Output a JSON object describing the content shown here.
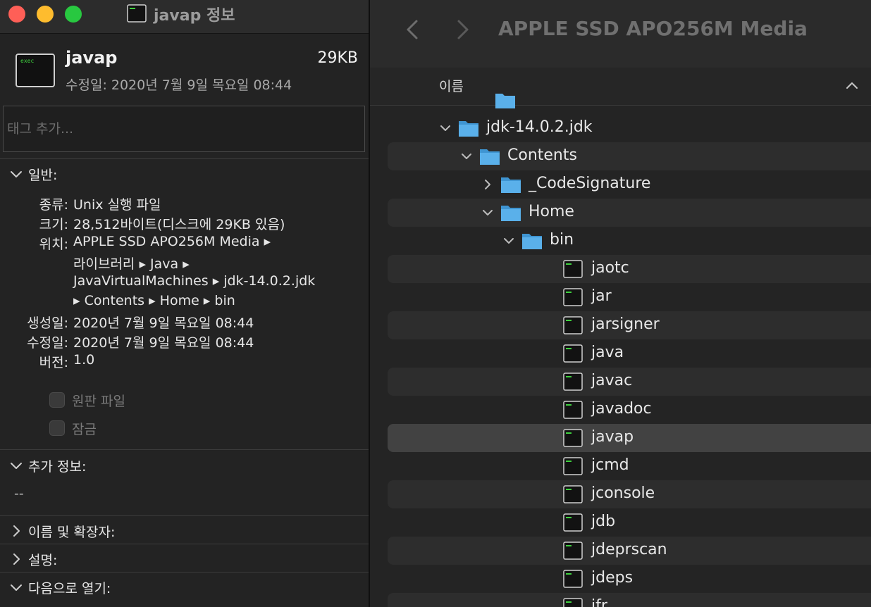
{
  "info_window": {
    "title": "javap 정보",
    "file_name": "javap",
    "file_size": "29KB",
    "modified_header": "수정일: 2020년 7월 9일 목요일 08:44",
    "tags_placeholder": "태그 추가...",
    "general": {
      "title": "일반:",
      "kind_label": "종류:",
      "kind_value": "Unix 실행 파일",
      "size_label": "크기:",
      "size_value": "28,512바이트(디스크에 29KB 있음)",
      "where_label": "위치:",
      "where_line1": "APPLE SSD APO256M Media ▸",
      "where_line2": "라이브러리 ▸ Java ▸",
      "where_line3": "JavaVirtualMachines ▸ jdk-14.0.2.jdk",
      "where_line4": "▸ Contents ▸ Home ▸ bin",
      "created_label": "생성일:",
      "created_value": "2020년 7월 9일 목요일 08:44",
      "modified_label": "수정일:",
      "modified_value": "2020년 7월 9일 목요일 08:44",
      "version_label": "버전:",
      "version_value": "1.0",
      "stationery_label": "원판 파일",
      "locked_label": "잠금"
    },
    "more_info": {
      "title": "추가 정보:",
      "value": "--"
    },
    "name_extension": {
      "title": "이름 및 확장자:"
    },
    "comments": {
      "title": "설명:"
    },
    "open_with": {
      "title": "다음으로 열기:"
    }
  },
  "finder": {
    "title": "APPLE SSD APO256M Media",
    "column_name": "이름",
    "rows": [
      {
        "label": "jdk-14.0.2.jdk",
        "kind": "folder",
        "expanded": true
      },
      {
        "label": "Contents",
        "kind": "folder",
        "expanded": true
      },
      {
        "label": "_CodeSignature",
        "kind": "folder",
        "expanded": false
      },
      {
        "label": "Home",
        "kind": "folder",
        "expanded": true
      },
      {
        "label": "bin",
        "kind": "folder",
        "expanded": true
      },
      {
        "label": "jaotc",
        "kind": "exec"
      },
      {
        "label": "jar",
        "kind": "exec"
      },
      {
        "label": "jarsigner",
        "kind": "exec"
      },
      {
        "label": "java",
        "kind": "exec"
      },
      {
        "label": "javac",
        "kind": "exec"
      },
      {
        "label": "javadoc",
        "kind": "exec"
      },
      {
        "label": "javap",
        "kind": "exec",
        "selected": true
      },
      {
        "label": "jcmd",
        "kind": "exec"
      },
      {
        "label": "jconsole",
        "kind": "exec"
      },
      {
        "label": "jdb",
        "kind": "exec"
      },
      {
        "label": "jdeprscan",
        "kind": "exec"
      },
      {
        "label": "jdeps",
        "kind": "exec"
      },
      {
        "label": "jfr",
        "kind": "exec"
      }
    ]
  },
  "icons": {
    "exec_badge": "exec",
    "colors": {
      "folder": "#5ab0ea",
      "selection": "#424242",
      "close": "#fe5f57",
      "minimize": "#febc2e",
      "zoom": "#28c840"
    }
  }
}
